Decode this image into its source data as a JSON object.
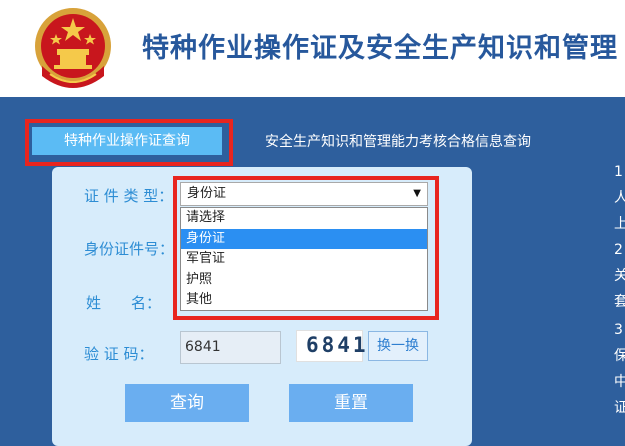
{
  "header": {
    "title": "特种作业操作证及安全生产知识和管理"
  },
  "tabs": [
    {
      "label": "特种作业操作证查询",
      "active": true
    },
    {
      "label": "安全生产知识和管理能力考核合格信息查询",
      "active": false
    }
  ],
  "form": {
    "cert_type_label": "证 件 类 型：",
    "id_number_label": "身份证件号：",
    "name_label": "姓　　名：",
    "captcha_label": "验 证 码：",
    "cert_type_selected": "身份证",
    "cert_type_options": [
      "请选择",
      "身份证",
      "军官证",
      "护照",
      "其他"
    ],
    "captcha_value": "6841",
    "captcha_image_text": "6841",
    "swap_label": "换一换",
    "query_label": "查询",
    "reset_label": "重置"
  },
  "side_notes": {
    "lines": [
      "1",
      "人",
      "上",
      "2",
      "关",
      "套",
      "3",
      "保",
      "中",
      "证"
    ]
  },
  "colors": {
    "header_title": "#27589c",
    "main_bg": "#2e5f9d",
    "tab_active": "#5bbbf4",
    "panel_bg": "#d7ecfb",
    "highlight_red": "#e8251f",
    "button_blue": "#6aaef0",
    "selected_option": "#2b8ff2"
  }
}
